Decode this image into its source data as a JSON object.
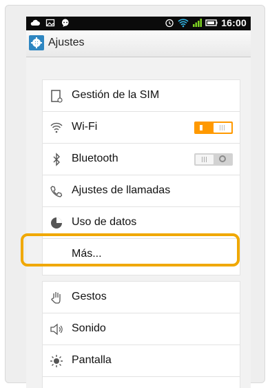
{
  "status_bar": {
    "time": "16:00",
    "icons": [
      "cloud-icon",
      "image-icon",
      "messenger-icon",
      "alarm-icon",
      "wifi-icon",
      "signal-icon",
      "battery-icon"
    ]
  },
  "app_bar": {
    "title": "Ajustes",
    "icon": "gear-icon"
  },
  "settings": {
    "group1": [
      {
        "label": "Gestión de la SIM",
        "icon": "sim-icon"
      },
      {
        "label": "Wi-Fi",
        "icon": "wifi-icon",
        "toggle": "on"
      },
      {
        "label": "Bluetooth",
        "icon": "bluetooth-icon",
        "toggle": "off"
      },
      {
        "label": "Ajustes de llamadas",
        "icon": "phone-icon"
      },
      {
        "label": "Uso de datos",
        "icon": "data-usage-icon"
      },
      {
        "label": "Más..."
      }
    ],
    "group2": [
      {
        "label": "Gestos",
        "icon": "hand-icon"
      },
      {
        "label": "Sonido",
        "icon": "speaker-icon"
      },
      {
        "label": "Pantalla",
        "icon": "brightness-icon"
      }
    ]
  },
  "colors": {
    "accent": "#ff9900",
    "highlight": "#f0a800",
    "statusbar": "#0b0b0b"
  }
}
